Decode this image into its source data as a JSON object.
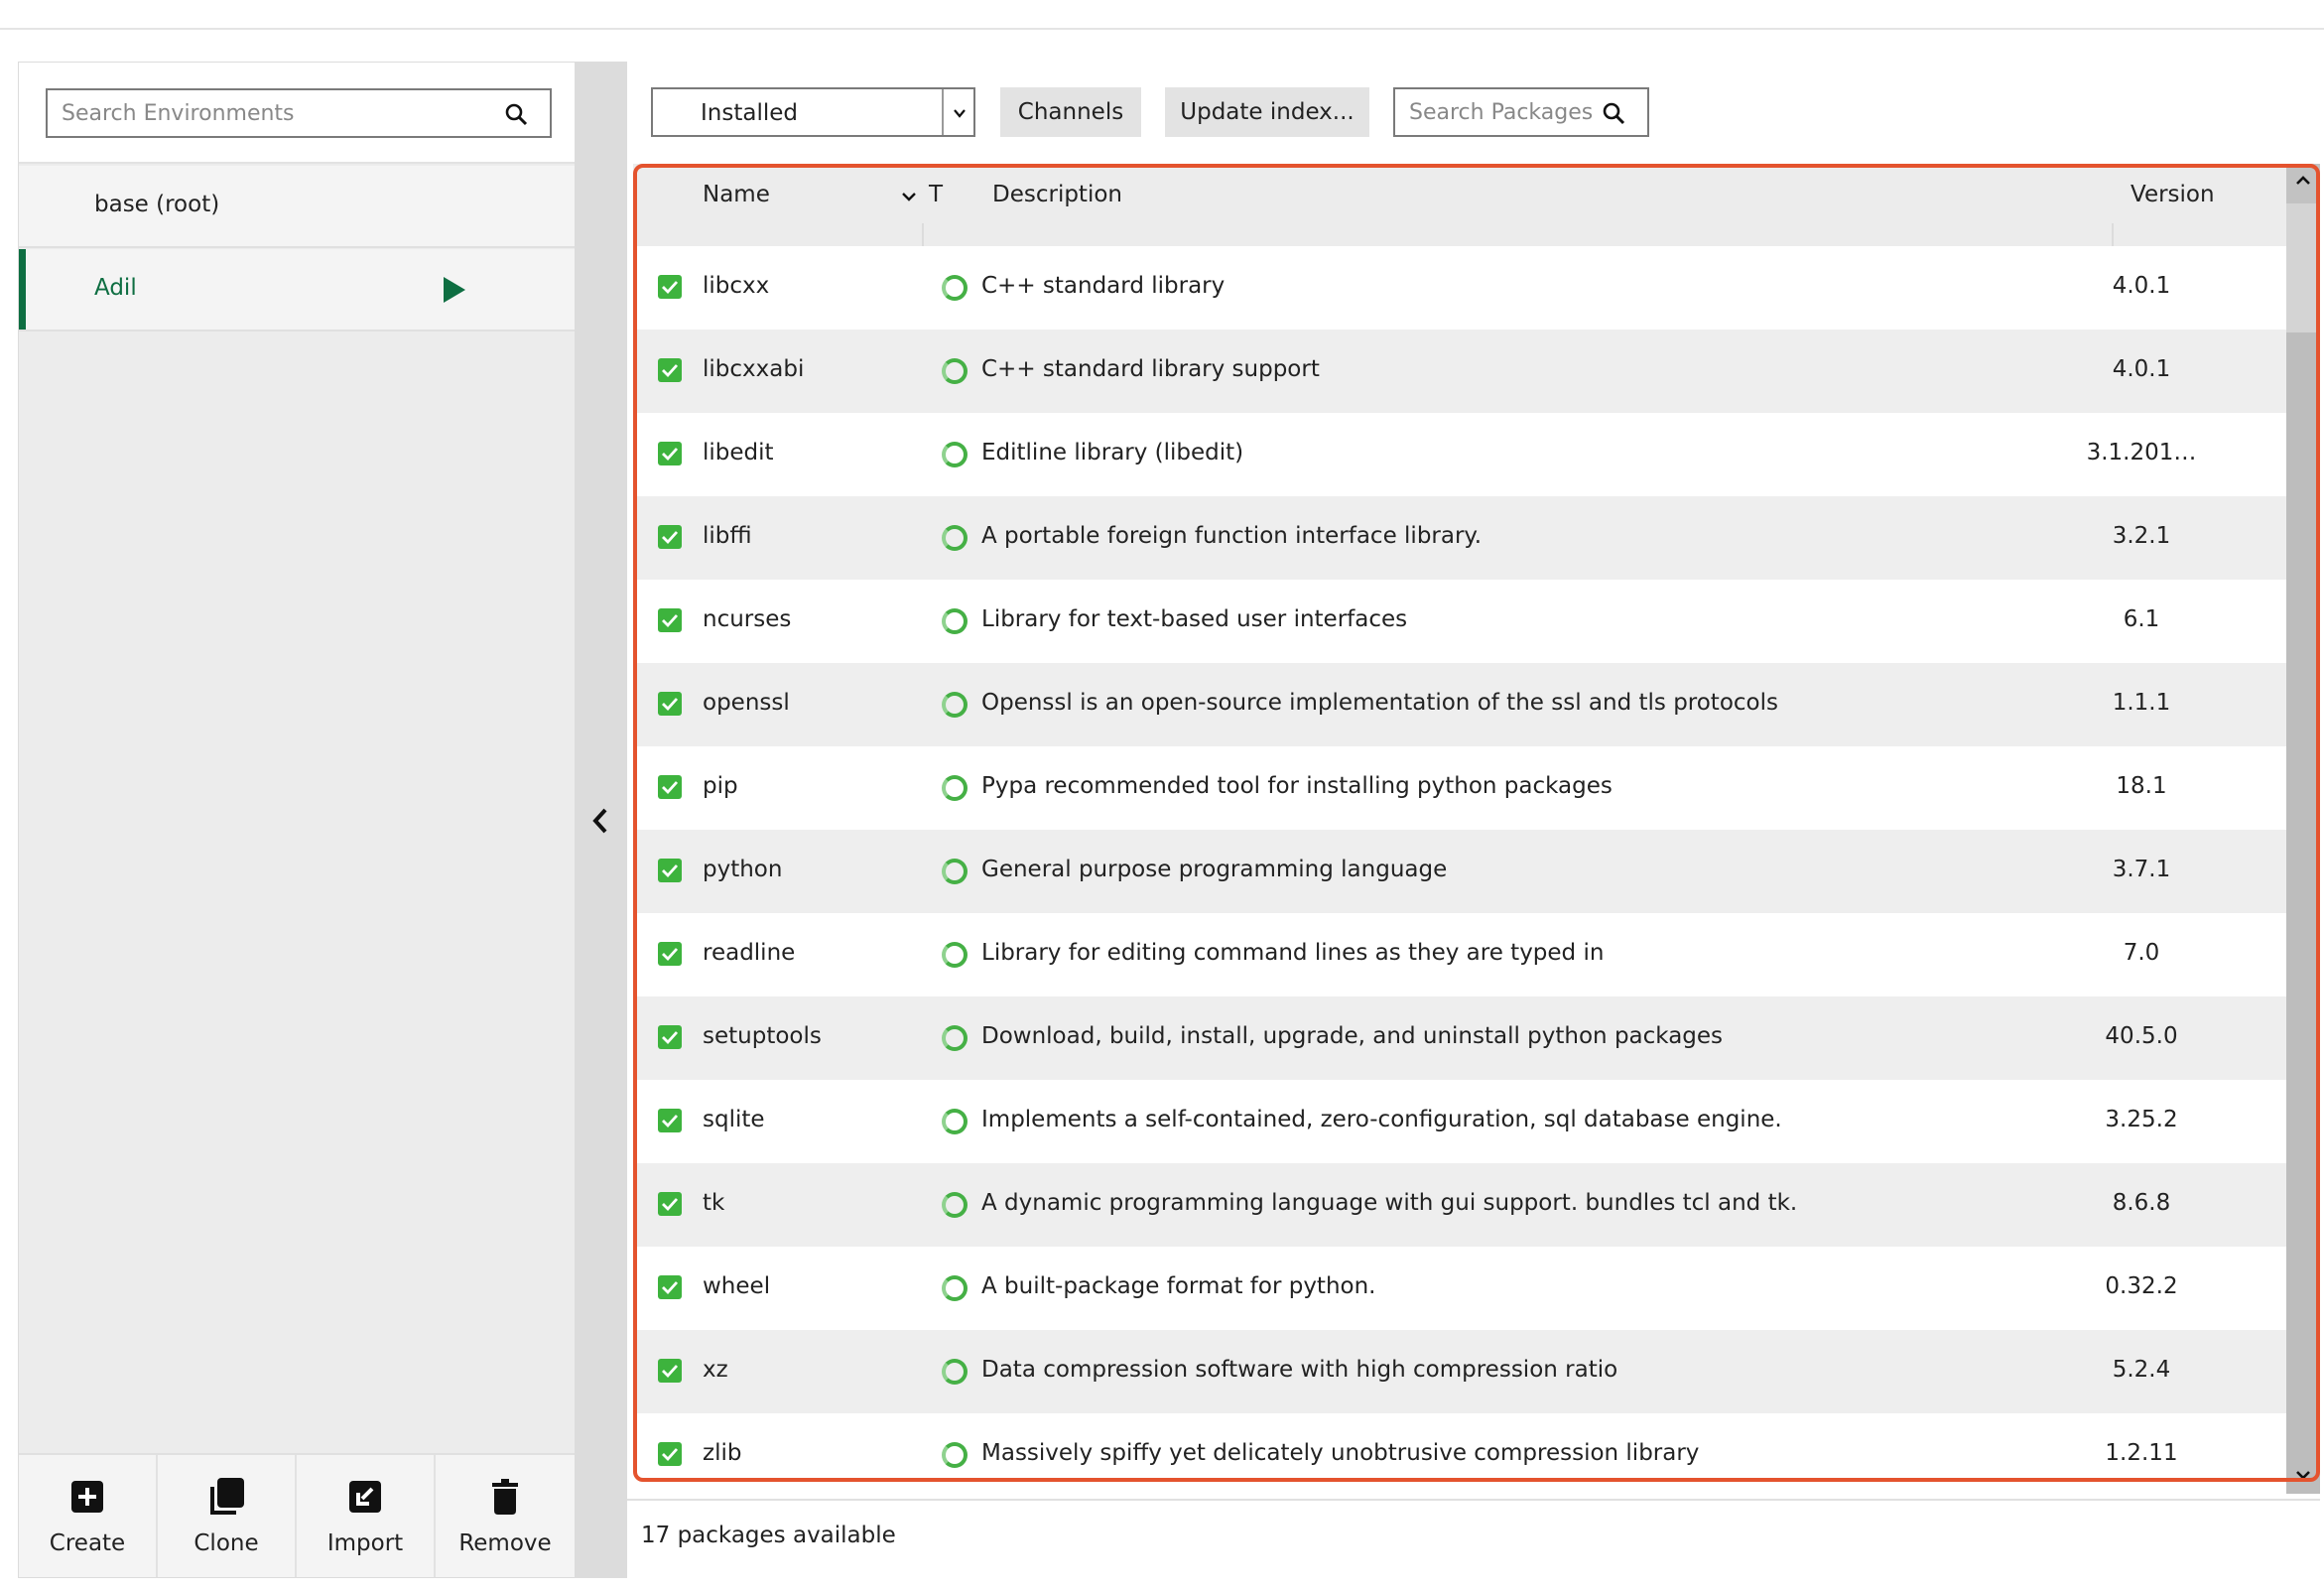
{
  "environments": {
    "search_placeholder": "Search Environments",
    "items": [
      {
        "label": "base (root)",
        "active": false
      },
      {
        "label": "Adil",
        "active": true
      }
    ],
    "actions": [
      {
        "label": "Create",
        "icon": "plus-box-icon"
      },
      {
        "label": "Clone",
        "icon": "clone-icon"
      },
      {
        "label": "Import",
        "icon": "import-icon"
      },
      {
        "label": "Remove",
        "icon": "trash-icon"
      }
    ]
  },
  "colors": {
    "accent": "#0e6e42",
    "checkbox": "#3db33d",
    "highlight": "#e4532e"
  },
  "toolbar": {
    "filter_value": "Installed",
    "channels_label": "Channels",
    "update_index_label": "Update index...",
    "search_placeholder": "Search Packages"
  },
  "table": {
    "columns": {
      "name": "Name",
      "type": "T",
      "description": "Description",
      "version": "Version"
    },
    "rows": [
      {
        "name": "libcxx",
        "description": "C++ standard library",
        "version": "4.0.1",
        "checked": true
      },
      {
        "name": "libcxxabi",
        "description": "C++ standard library support",
        "version": "4.0.1",
        "checked": true
      },
      {
        "name": "libedit",
        "description": "Editline library (libedit)",
        "version": "3.1.201…",
        "checked": true
      },
      {
        "name": "libffi",
        "description": "A portable foreign function interface library.",
        "version": "3.2.1",
        "checked": true
      },
      {
        "name": "ncurses",
        "description": "Library for text-based user interfaces",
        "version": "6.1",
        "checked": true
      },
      {
        "name": "openssl",
        "description": "Openssl is an open-source implementation of the ssl and tls protocols",
        "version": "1.1.1",
        "checked": true
      },
      {
        "name": "pip",
        "description": "Pypa recommended tool for installing python packages",
        "version": "18.1",
        "checked": true
      },
      {
        "name": "python",
        "description": "General purpose programming language",
        "version": "3.7.1",
        "checked": true
      },
      {
        "name": "readline",
        "description": "Library for editing command lines as they are typed in",
        "version": "7.0",
        "checked": true
      },
      {
        "name": "setuptools",
        "description": "Download, build, install, upgrade, and uninstall python packages",
        "version": "40.5.0",
        "checked": true
      },
      {
        "name": "sqlite",
        "description": "Implements a self-contained, zero-configuration, sql database engine.",
        "version": "3.25.2",
        "checked": true
      },
      {
        "name": "tk",
        "description": "A dynamic programming language with gui support.  bundles tcl and tk.",
        "version": "8.6.8",
        "checked": true
      },
      {
        "name": "wheel",
        "description": "A built-package format for python.",
        "version": "0.32.2",
        "checked": true
      },
      {
        "name": "xz",
        "description": "Data compression software with high compression ratio",
        "version": "5.2.4",
        "checked": true
      },
      {
        "name": "zlib",
        "description": "Massively spiffy yet delicately unobtrusive compression library",
        "version": "1.2.11",
        "checked": true
      }
    ]
  },
  "status": {
    "text": "17 packages available"
  }
}
